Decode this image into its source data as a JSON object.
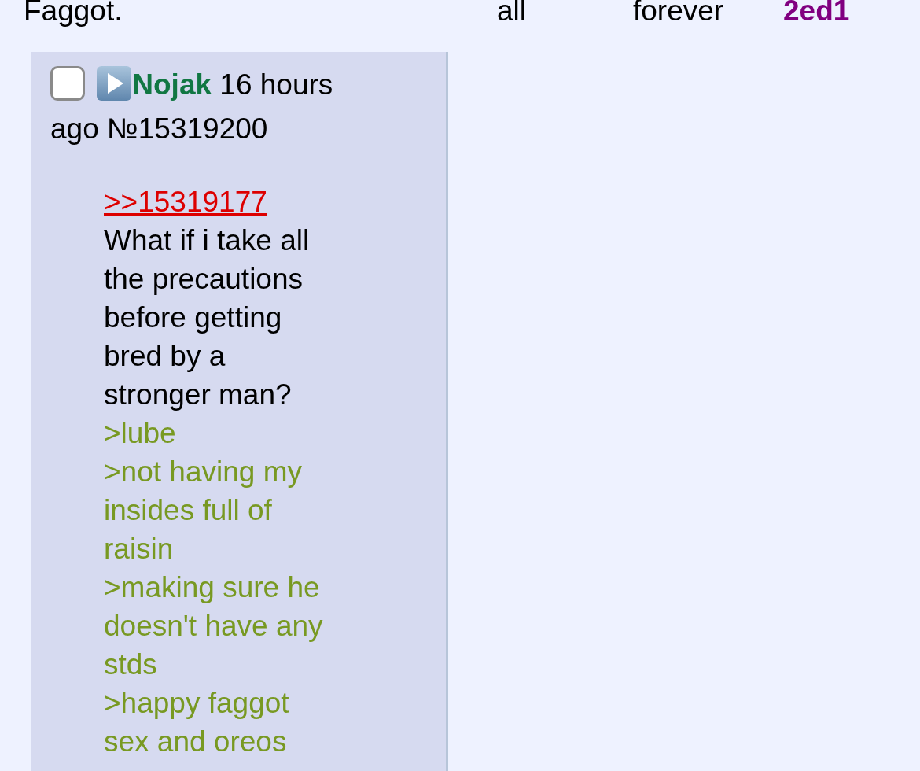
{
  "top_row": [
    {
      "text": "Faggot.",
      "kind": "plain"
    },
    {
      "text": "all",
      "kind": "plain"
    },
    {
      "text": "forever",
      "kind": "plain"
    },
    {
      "text": "2ed1",
      "kind": "id"
    }
  ],
  "post": {
    "checked": false,
    "name": "Nojak",
    "time_lines": [
      "16 hours",
      "ago"
    ],
    "number": "№15319200",
    "quote_link": ">>15319177",
    "lines": [
      {
        "text": "What if i take all the precautions before getting bred by a stronger man?",
        "kind": "text"
      },
      {
        "text": ">lube",
        "kind": "greentext"
      },
      {
        "text": ">not having my insides full of raisin",
        "kind": "greentext"
      },
      {
        "text": ">making sure he doesn't have any stds",
        "kind": "greentext"
      },
      {
        "text": ">happy faggot sex and oreos",
        "kind": "greentext"
      }
    ]
  }
}
